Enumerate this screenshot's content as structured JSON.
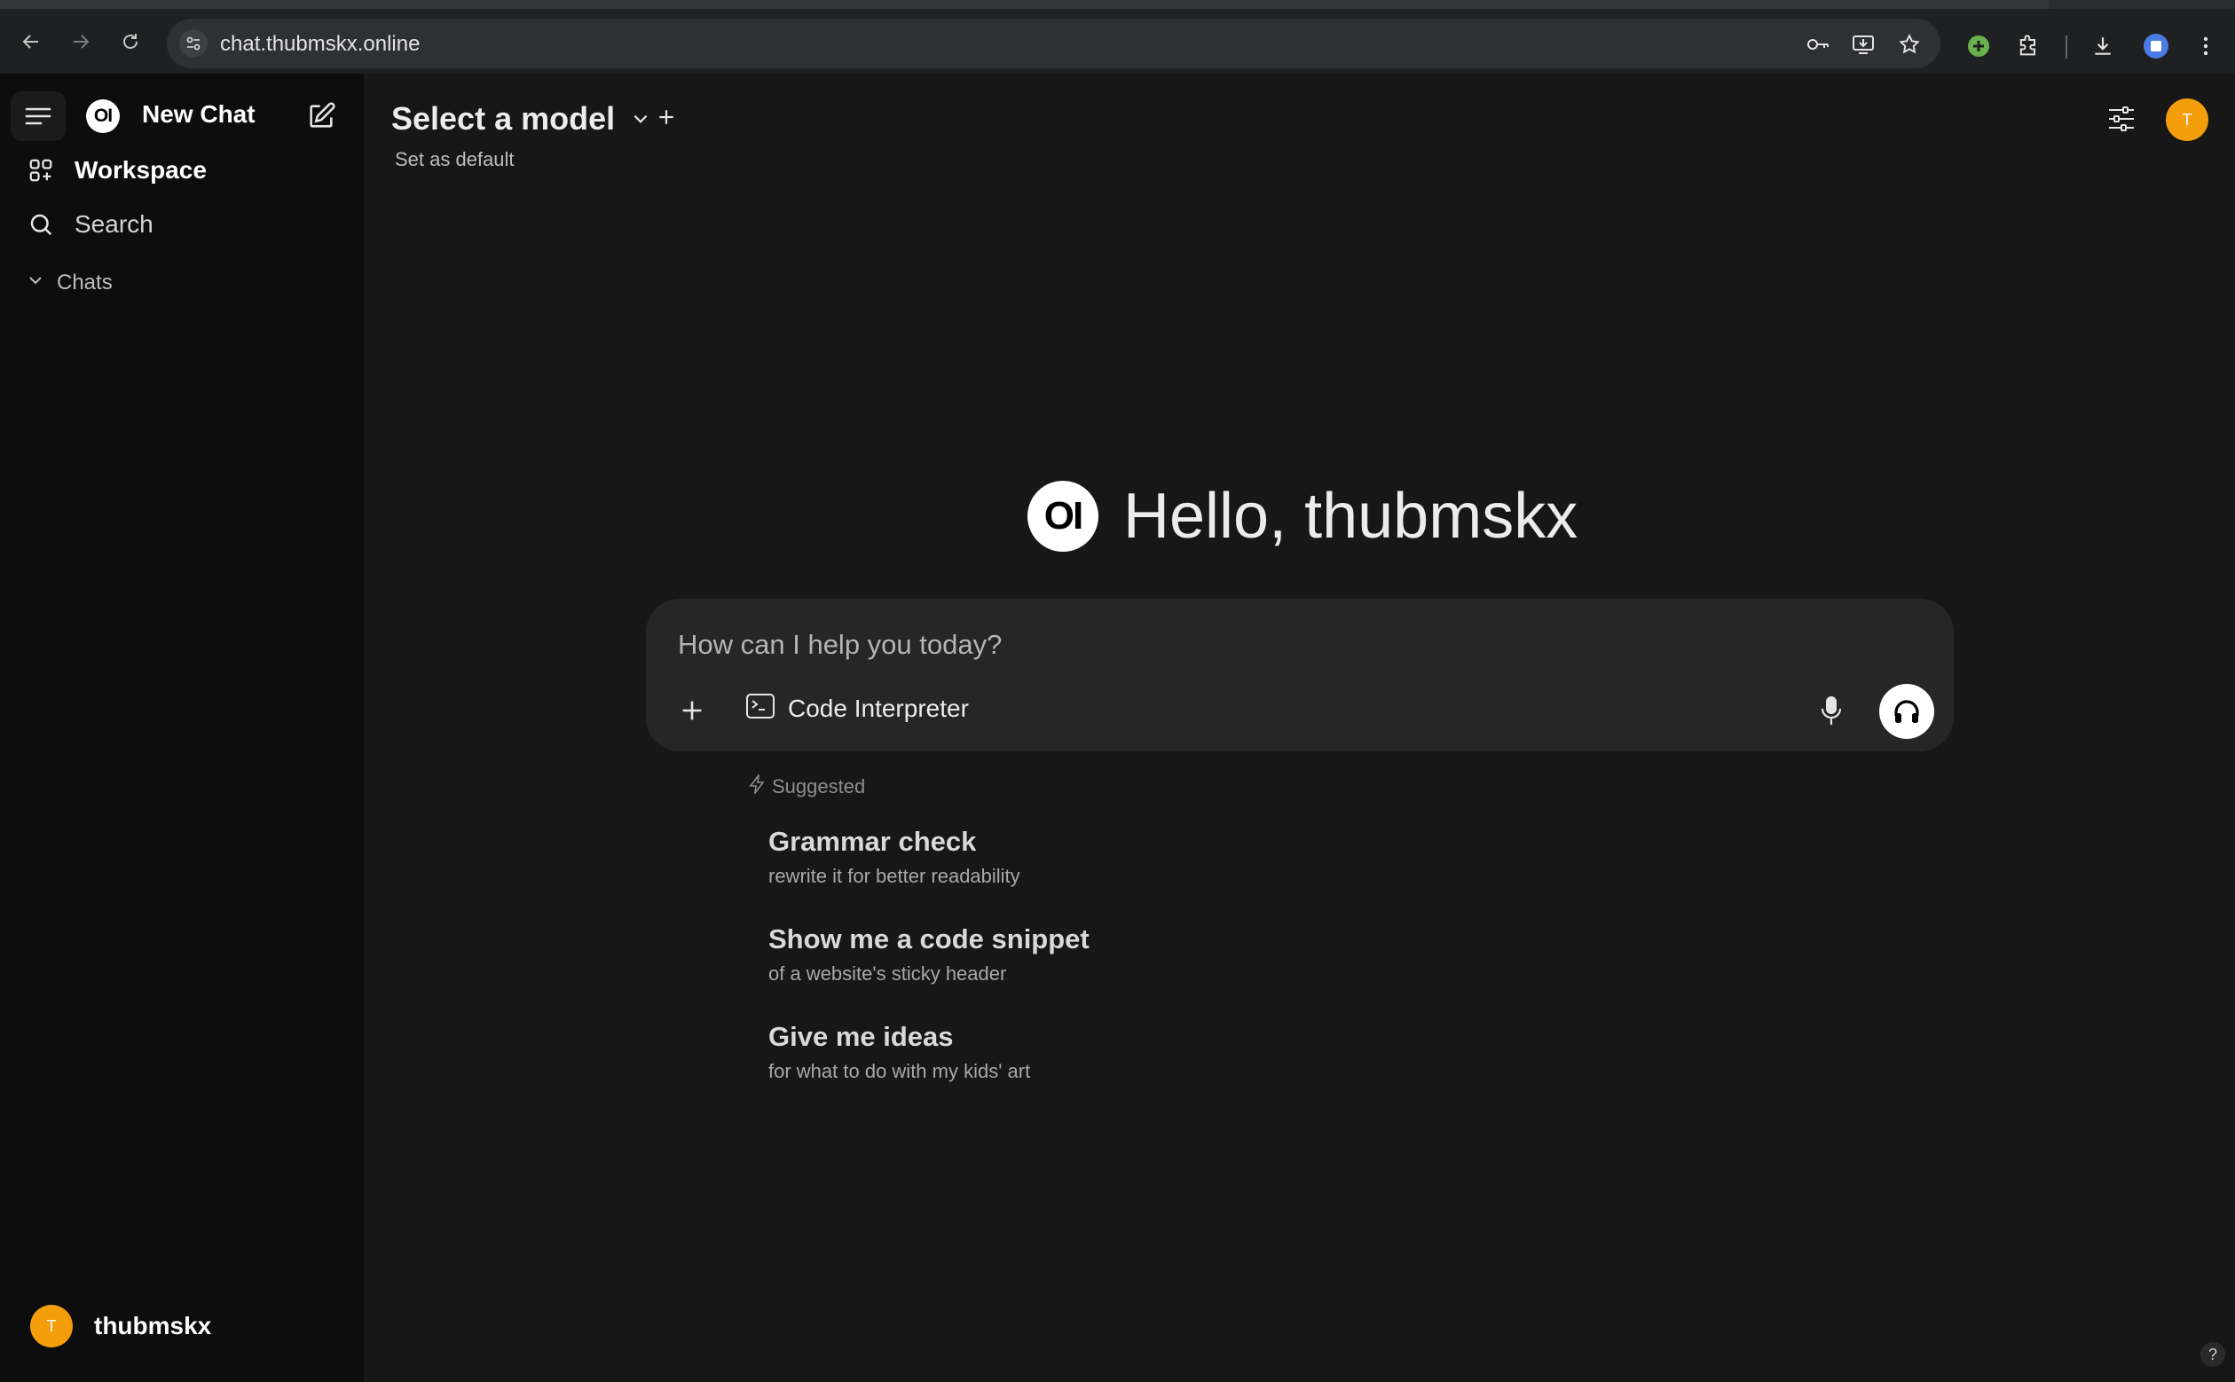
{
  "browser": {
    "url": "chat.thubmskx.online"
  },
  "sidebar": {
    "new_chat_label": "New Chat",
    "logo_text": "OI",
    "items": [
      {
        "label": "Workspace",
        "icon": "grid-plus-icon"
      },
      {
        "label": "Search",
        "icon": "search-icon"
      }
    ],
    "chats_label": "Chats",
    "user": {
      "initial": "T",
      "name": "thubmskx"
    }
  },
  "header": {
    "model_select_label": "Select a model",
    "set_default_label": "Set as default",
    "avatar_initial": "T"
  },
  "main": {
    "logo_text": "OI",
    "greeting": "Hello, thubmskx",
    "composer": {
      "placeholder": "How can I help you today?",
      "tool_label": "Code Interpreter"
    },
    "suggested_label": "Suggested",
    "suggestions": [
      {
        "title": "Grammar check",
        "subtitle": "rewrite it for better readability"
      },
      {
        "title": "Show me a code snippet",
        "subtitle": "of a website's sticky header"
      },
      {
        "title": "Give me ideas",
        "subtitle": "for what to do with my kids' art"
      }
    ],
    "help_label": "?"
  },
  "colors": {
    "sidebar_bg": "#0d0d0d",
    "main_bg": "#171717",
    "composer_bg": "#262626",
    "avatar": "#f59e0b"
  }
}
